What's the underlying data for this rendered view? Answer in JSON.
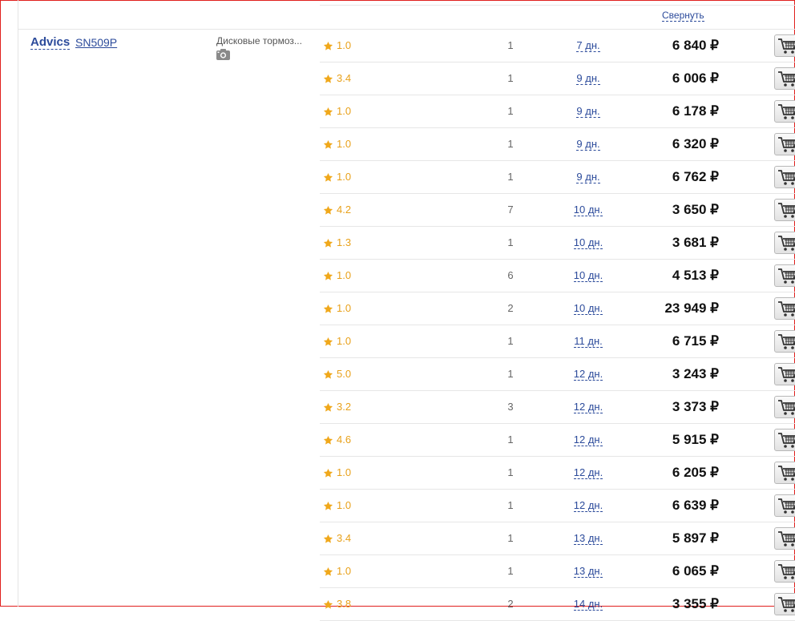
{
  "header": {
    "collapse_label": "Свернуть"
  },
  "product": {
    "brand": "Advics",
    "article": "SN509P",
    "description": "Дисковые тормоз...",
    "photo_icon": "camera-icon"
  },
  "colors": {
    "link": "#2c4b9b",
    "rating": "#e8a11b",
    "frame": "#e0201e"
  },
  "offers": [
    {
      "rating": "1.0",
      "qty": "1",
      "delivery": "7 дн.",
      "price": "6 840 ₽"
    },
    {
      "rating": "3.4",
      "qty": "1",
      "delivery": "9 дн.",
      "price": "6 006 ₽"
    },
    {
      "rating": "1.0",
      "qty": "1",
      "delivery": "9 дн.",
      "price": "6 178 ₽"
    },
    {
      "rating": "1.0",
      "qty": "1",
      "delivery": "9 дн.",
      "price": "6 320 ₽"
    },
    {
      "rating": "1.0",
      "qty": "1",
      "delivery": "9 дн.",
      "price": "6 762 ₽"
    },
    {
      "rating": "4.2",
      "qty": "7",
      "delivery": "10 дн.",
      "price": "3 650 ₽"
    },
    {
      "rating": "1.3",
      "qty": "1",
      "delivery": "10 дн.",
      "price": "3 681 ₽"
    },
    {
      "rating": "1.0",
      "qty": "6",
      "delivery": "10 дн.",
      "price": "4 513 ₽"
    },
    {
      "rating": "1.0",
      "qty": "2",
      "delivery": "10 дн.",
      "price": "23 949 ₽"
    },
    {
      "rating": "1.0",
      "qty": "1",
      "delivery": "11 дн.",
      "price": "6 715 ₽"
    },
    {
      "rating": "5.0",
      "qty": "1",
      "delivery": "12 дн.",
      "price": "3 243 ₽"
    },
    {
      "rating": "3.2",
      "qty": "3",
      "delivery": "12 дн.",
      "price": "3 373 ₽"
    },
    {
      "rating": "4.6",
      "qty": "1",
      "delivery": "12 дн.",
      "price": "5 915 ₽"
    },
    {
      "rating": "1.0",
      "qty": "1",
      "delivery": "12 дн.",
      "price": "6 205 ₽"
    },
    {
      "rating": "1.0",
      "qty": "1",
      "delivery": "12 дн.",
      "price": "6 639 ₽"
    },
    {
      "rating": "3.4",
      "qty": "1",
      "delivery": "13 дн.",
      "price": "5 897 ₽"
    },
    {
      "rating": "1.0",
      "qty": "1",
      "delivery": "13 дн.",
      "price": "6 065 ₽"
    },
    {
      "rating": "3.8",
      "qty": "2",
      "delivery": "14 дн.",
      "price": "3 355 ₽"
    }
  ],
  "icons": {
    "rating": "star-icon",
    "cart": "cart-icon"
  }
}
